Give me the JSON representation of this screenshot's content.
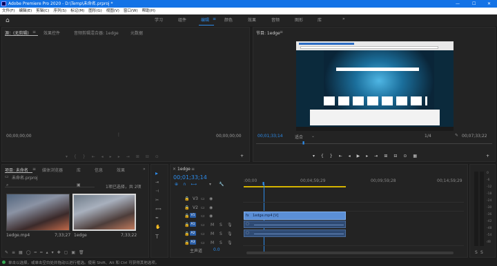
{
  "title": "Adobe Premiere Pro 2020 - D:\\Temp\\未命名.prproj *",
  "window_controls": [
    "—",
    "☐",
    "✕"
  ],
  "menu": [
    "文件(F)",
    "编辑(E)",
    "剪辑(C)",
    "序列(S)",
    "标记(M)",
    "图形(G)",
    "视图(V)",
    "窗口(W)",
    "帮助(H)"
  ],
  "workspaces": [
    "学习",
    "组件",
    "编辑",
    "颜色",
    "效果",
    "音频",
    "图形",
    "库"
  ],
  "workspace_more": "»",
  "source": {
    "tabs": [
      "源：(无剪辑)",
      "效果控件",
      "音频剪辑混合器: 1edge",
      "元数据"
    ],
    "tc_left": "00;00;00;00",
    "tc_right": "00;00;00;00"
  },
  "program": {
    "tab": "节目: 1edge",
    "tc": "00;01;33;14",
    "fit": "适合",
    "ratio": "1/4",
    "duration": "00;07;33;22"
  },
  "project": {
    "tabs": [
      "项目: 未命名",
      "媒体浏览器",
      "库",
      "信息",
      "效果"
    ],
    "file": "未命名.prproj",
    "selection": "1项已选择，共 2项",
    "items": [
      {
        "name": "1edge.mp4",
        "dur": "7;33;27"
      },
      {
        "name": "1edge",
        "dur": "7;33;22"
      }
    ]
  },
  "timeline": {
    "tab": "1edge",
    "tc": "00;01;33;14",
    "ruler": [
      ":00;00",
      "00;04;59;29",
      "00;09;59;28",
      "00;14;59;29"
    ],
    "tracks": [
      "V3",
      "V2",
      "V1",
      "A1",
      "A2",
      "A3"
    ],
    "clip_label": "1edge.mp4 [V]",
    "master": "主声道",
    "master_val": "0.0"
  },
  "meter": [
    "0",
    "-6",
    "-12",
    "-18",
    "-24",
    "-30",
    "-36",
    "-42",
    "-48",
    "-54",
    "dB"
  ],
  "meter_bottom": [
    "S",
    "S"
  ],
  "status": "单击以选择，或单击空白处并拖动以进行框选。使用 Shift、Alt 和 Ctrl 可获得其他选项。"
}
